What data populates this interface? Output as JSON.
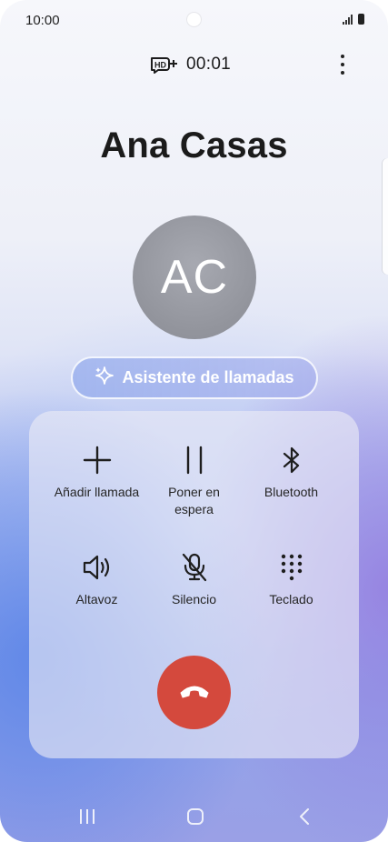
{
  "status_bar": {
    "time": "10:00"
  },
  "call": {
    "quality_icon": "hd-plus-icon",
    "timer": "00:01"
  },
  "contact": {
    "name": "Ana Casas",
    "initials": "AC"
  },
  "assistant": {
    "label": "Asistente de llamadas",
    "icon": "sparkle-icon"
  },
  "controls": [
    {
      "label": "Añadir llamada",
      "icon": "plus-icon"
    },
    {
      "label": "Poner en espera",
      "icon": "pause-icon"
    },
    {
      "label": "Bluetooth",
      "icon": "bluetooth-icon"
    },
    {
      "label": "Altavoz",
      "icon": "speaker-icon"
    },
    {
      "label": "Silencio",
      "icon": "mic-off-icon"
    },
    {
      "label": "Teclado",
      "icon": "keypad-icon"
    }
  ],
  "end_call": {
    "icon": "hang-up-icon",
    "color": "#d4493d"
  },
  "nav": {
    "recent": "recent-apps-icon",
    "home": "home-icon",
    "back": "back-icon"
  }
}
